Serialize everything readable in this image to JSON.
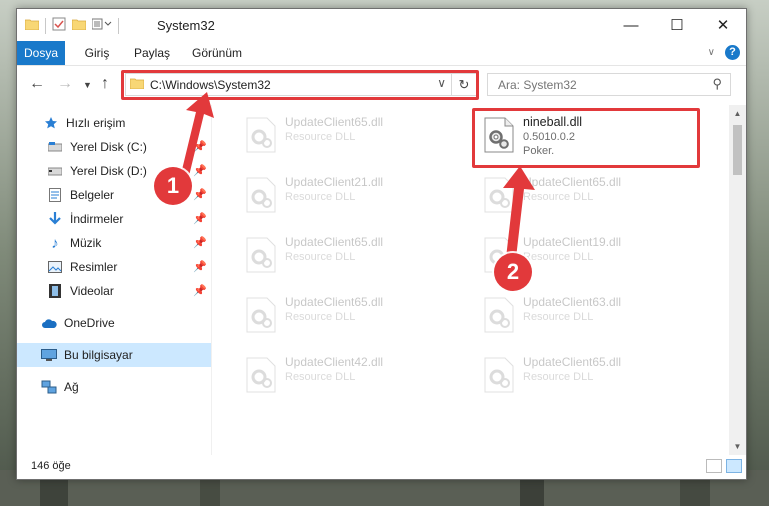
{
  "window": {
    "title": "System32"
  },
  "ribbon": {
    "tabs": [
      "Dosya",
      "Giriş",
      "Paylaş",
      "Görünüm"
    ],
    "help_label": "?"
  },
  "nav": {
    "address": "C:\\Windows\\System32",
    "search_placeholder": "Ara: System32"
  },
  "sidebar": {
    "items": [
      {
        "label": "Hızlı erişim",
        "icon": "star-icon",
        "pinned": false
      },
      {
        "label": "Yerel Disk (C:)",
        "icon": "drive-icon",
        "pinned": true
      },
      {
        "label": "Yerel Disk (D:)",
        "icon": "drive-icon",
        "pinned": true
      },
      {
        "label": "Belgeler",
        "icon": "documents-icon",
        "pinned": true
      },
      {
        "label": "İndirmeler",
        "icon": "download-icon",
        "pinned": true
      },
      {
        "label": "Müzik",
        "icon": "music-icon",
        "pinned": true
      },
      {
        "label": "Resimler",
        "icon": "pictures-icon",
        "pinned": true
      },
      {
        "label": "Videolar",
        "icon": "video-icon",
        "pinned": true
      },
      {
        "label": "OneDrive",
        "icon": "cloud-icon",
        "pinned": false
      },
      {
        "label": "Bu bilgisayar",
        "icon": "computer-icon",
        "pinned": false,
        "selected": true
      },
      {
        "label": "Ağ",
        "icon": "network-icon",
        "pinned": false
      }
    ]
  },
  "files": [
    {
      "name": "UpdateClient65.dll",
      "line2": "Resource DLL",
      "line3": "",
      "faded": true
    },
    {
      "name": "nineball.dll",
      "line2": "0.5010.0.2",
      "line3": "Poker.",
      "faded": false
    },
    {
      "name": "UpdateClient21.dll",
      "line2": "Resource DLL",
      "line3": "",
      "faded": true
    },
    {
      "name": "UpdateClient65.dll",
      "line2": "Resource DLL",
      "line3": "",
      "faded": true
    },
    {
      "name": "UpdateClient65.dll",
      "line2": "Resource DLL",
      "line3": "",
      "faded": true
    },
    {
      "name": "UpdateClient19.dll",
      "line2": "Resource DLL",
      "line3": "",
      "faded": true
    },
    {
      "name": "UpdateClient65.dll",
      "line2": "Resource DLL",
      "line3": "",
      "faded": true
    },
    {
      "name": "UpdateClient63.dll",
      "line2": "Resource DLL",
      "line3": "",
      "faded": true
    },
    {
      "name": "UpdateClient42.dll",
      "line2": "Resource DLL",
      "line3": "",
      "faded": true
    },
    {
      "name": "UpdateClient65.dll",
      "line2": "Resource DLL",
      "line3": "",
      "faded": true
    }
  ],
  "status": {
    "item_count": "146 öğe"
  },
  "callouts": {
    "step1": "1",
    "step2": "2"
  },
  "colors": {
    "accent": "#1979ca",
    "highlight": "#e2393b",
    "selection": "#cce8ff"
  }
}
